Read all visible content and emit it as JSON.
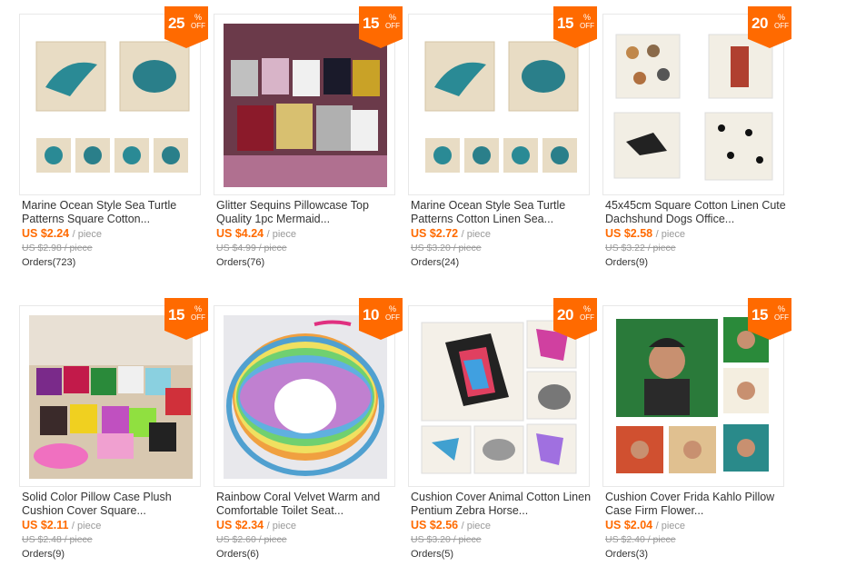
{
  "products": [
    {
      "title": "Marine Ocean Style Sea Turtle Patterns Square Cotton...",
      "discount": "25",
      "percent_sign": "%",
      "off_label": "OFF",
      "price": "US $2.24",
      "unit": "/ piece",
      "old_price": "US $2.98 / piece",
      "orders": "Orders(723)",
      "image": "sea-pillows-4-small"
    },
    {
      "title": "Glitter Sequins Pillowcase Top Quality 1pc Mermaid...",
      "discount": "15",
      "percent_sign": "%",
      "off_label": "OFF",
      "price": "US $4.24",
      "unit": "/ piece",
      "old_price": "US $4.99 / piece",
      "orders": "Orders(76)",
      "image": "sequin-pillows"
    },
    {
      "title": "Marine Ocean Style Sea Turtle Patterns Cotton Linen Sea...",
      "discount": "15",
      "percent_sign": "%",
      "off_label": "OFF",
      "price": "US $2.72",
      "unit": "/ piece",
      "old_price": "US $3.20 / piece",
      "orders": "Orders(24)",
      "image": "sea-pillows-4-small"
    },
    {
      "title": "45x45cm Square Cotton Linen Cute Dachshund Dogs Office...",
      "discount": "20",
      "percent_sign": "%",
      "off_label": "OFF",
      "price": "US $2.58",
      "unit": "/ piece",
      "old_price": "US $3.22 / piece",
      "orders": "Orders(9)",
      "image": "dog-pillows"
    },
    {
      "title": "Solid Color Pillow Case Plush Cushion Cover Square...",
      "discount": "15",
      "percent_sign": "%",
      "off_label": "OFF",
      "price": "US $2.11",
      "unit": "/ piece",
      "old_price": "US $2.48 / piece",
      "orders": "Orders(9)",
      "image": "plush-pillows"
    },
    {
      "title": "Rainbow Coral Velvet Warm and Comfortable Toilet Seat...",
      "discount": "10",
      "percent_sign": "%",
      "off_label": "OFF",
      "price": "US $2.34",
      "unit": "/ piece",
      "old_price": "US $2.60 / piece",
      "orders": "Orders(6)",
      "image": "rainbow-toilet-seat"
    },
    {
      "title": "Cushion Cover Animal Cotton Linen Pentium Zebra Horse...",
      "discount": "20",
      "percent_sign": "%",
      "off_label": "OFF",
      "price": "US $2.56",
      "unit": "/ piece",
      "old_price": "US $3.20 / piece",
      "orders": "Orders(5)",
      "image": "animal-pillows"
    },
    {
      "title": "Cushion Cover Frida Kahlo Pillow Case Firm Flower...",
      "discount": "15",
      "percent_sign": "%",
      "off_label": "OFF",
      "price": "US $2.04",
      "unit": "/ piece",
      "old_price": "US $2.40 / piece",
      "orders": "Orders(3)",
      "image": "portrait-pillows"
    }
  ],
  "colors": {
    "accent": "#ff6a00",
    "text": "#333333",
    "muted": "#999999",
    "border": "#e8e8e8"
  }
}
